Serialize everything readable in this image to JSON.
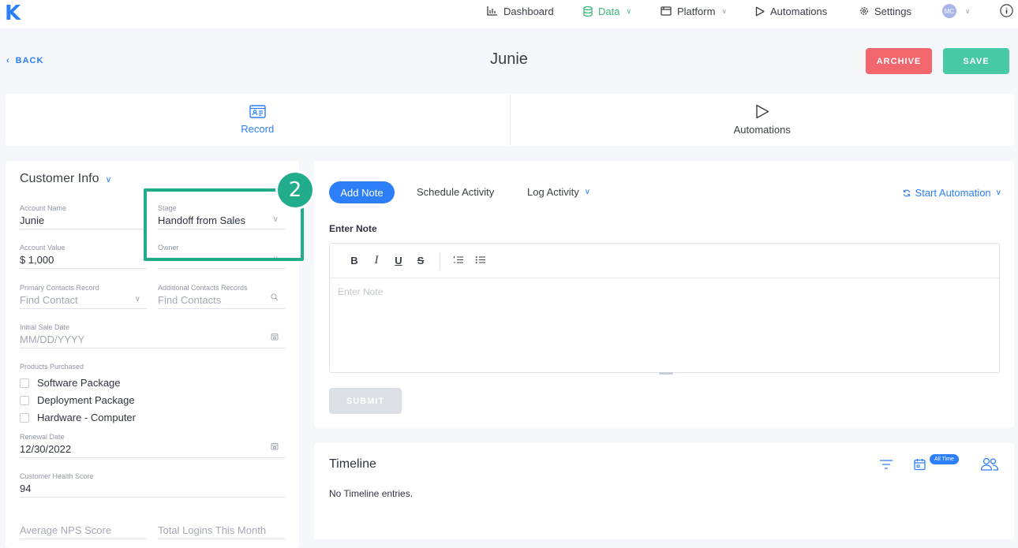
{
  "app": {
    "logo": "K"
  },
  "nav": [
    {
      "label": "Dashboard",
      "icon": "bar-chart-icon"
    },
    {
      "label": "Data",
      "icon": "database-icon",
      "active": true
    },
    {
      "label": "Platform",
      "icon": "browser-window-icon"
    },
    {
      "label": "Automations",
      "icon": "play-icon"
    },
    {
      "label": "Settings",
      "icon": "gear-icon"
    }
  ],
  "user": {
    "initials": "MC"
  },
  "header": {
    "back_label": "BACK",
    "title": "Junie",
    "archive_label": "ARCHIVE",
    "save_label": "SAVE"
  },
  "tabs": [
    {
      "label": "Record",
      "icon": "id-card-icon",
      "active": true
    },
    {
      "label": "Automations",
      "icon": "play-icon"
    }
  ],
  "customer_info": {
    "title": "Customer Info",
    "account_name": {
      "label": "Account Name",
      "value": "Junie"
    },
    "stage": {
      "label": "Stage",
      "value": "Handoff from Sales"
    },
    "account_value": {
      "label": "Account Value",
      "value": "$  1,000"
    },
    "owner": {
      "label": "Owner",
      "value": ""
    },
    "primary_contacts": {
      "label": "Primary Contacts Record",
      "placeholder": "Find Contact"
    },
    "additional_contacts": {
      "label": "Additional Contacts Records",
      "placeholder": "Find Contacts"
    },
    "initial_sale_date": {
      "label": "Initial Sale Date",
      "placeholder": "MM/DD/YYYY"
    },
    "products": {
      "label": "Products Purchased",
      "options": [
        "Software Package",
        "Deployment Package",
        "Hardware - Computer"
      ]
    },
    "renewal_date": {
      "label": "Renewal Date",
      "value": "12/30/2022"
    },
    "health_score": {
      "label": "Customer Health Score",
      "value": "94"
    },
    "nps_score": {
      "placeholder": "Average NPS Score"
    },
    "logins": {
      "placeholder": "Total Logins This Month"
    }
  },
  "annotation": {
    "step": "2",
    "color": "#21ad8b"
  },
  "notes": {
    "tabs": [
      "Add Note",
      "Schedule Activity",
      "Log Activity"
    ],
    "start_automation": "Start Automation",
    "enter_note_label": "Enter Note",
    "editor_placeholder": "Enter Note",
    "toolbar": [
      "B",
      "I",
      "U",
      "S"
    ],
    "submit_label": "SUBMIT"
  },
  "timeline": {
    "title": "Timeline",
    "empty_text": "No Timeline entries.",
    "range_badge": "All Time"
  },
  "colors": {
    "primary": "#2d7ff9",
    "data_active": "#3cb878",
    "archive": "#f2666d",
    "save": "#48c9a6"
  }
}
